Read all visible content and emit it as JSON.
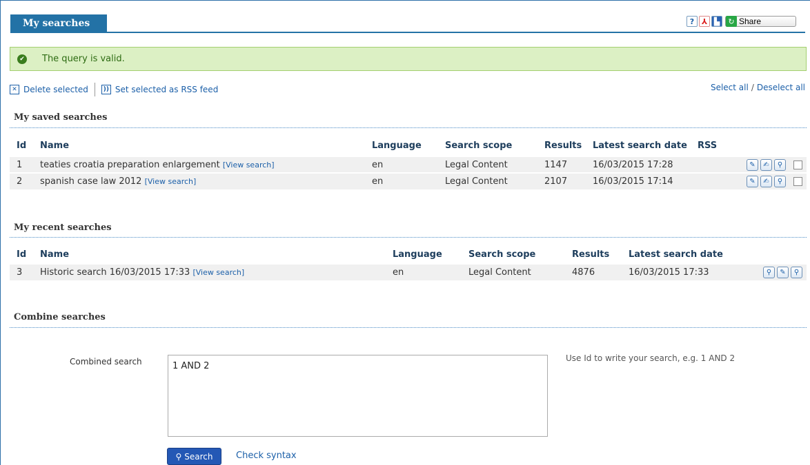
{
  "header": {
    "title": "My searches"
  },
  "toolbar": {
    "help_glyph": "?",
    "pdf_glyph": "⅄",
    "print_glyph": "▙",
    "share_label": "Share"
  },
  "alert": {
    "message": "The query is valid.",
    "icon": "check-icon"
  },
  "actions": {
    "delete_label": "Delete selected",
    "rss_label": "Set selected as RSS feed",
    "select_all": "Select all",
    "slash": "/",
    "deselect_all": "Deselect all"
  },
  "saved": {
    "title": "My saved searches",
    "columns": {
      "id": "Id",
      "name": "Name",
      "language": "Language",
      "scope": "Search scope",
      "results": "Results",
      "date": "Latest search date",
      "rss": "RSS"
    },
    "rows": [
      {
        "id": "1",
        "name": "teaties croatia preparation enlargement",
        "view": "[View search]",
        "language": "en",
        "scope": "Legal Content",
        "results": "1147",
        "date": "16/03/2015 17:28"
      },
      {
        "id": "2",
        "name": "spanish case law 2012",
        "view": "[View search]",
        "language": "en",
        "scope": "Legal Content",
        "results": "2107",
        "date": "16/03/2015 17:14"
      }
    ]
  },
  "recent": {
    "title": "My recent searches",
    "columns": {
      "id": "Id",
      "name": "Name",
      "language": "Language",
      "scope": "Search scope",
      "results": "Results",
      "date": "Latest search date"
    },
    "rows": [
      {
        "id": "3",
        "name": "Historic search 16/03/2015 17:33",
        "view": "[View search]",
        "language": "en",
        "scope": "Legal Content",
        "results": "4876",
        "date": "16/03/2015 17:33"
      }
    ]
  },
  "combine": {
    "title": "Combine searches",
    "label": "Combined search",
    "value": "1 AND 2",
    "hint": "Use Id to write your search, e.g. 1 AND 2",
    "search_label": "Search",
    "check_label": "Check syntax"
  }
}
